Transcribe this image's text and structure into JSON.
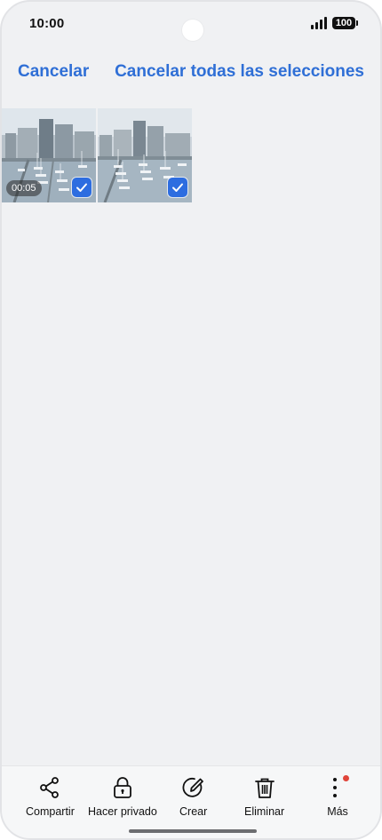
{
  "status_bar": {
    "time": "10:00",
    "battery": "100"
  },
  "header": {
    "cancel_label": "Cancelar",
    "cancel_all_label": "Cancelar todas las selecciones"
  },
  "gallery": {
    "items": [
      {
        "type": "video",
        "duration": "00:05",
        "selected": true
      },
      {
        "type": "photo",
        "selected": true
      }
    ]
  },
  "toolbar": {
    "items": [
      {
        "label": "Compartir",
        "icon": "share-icon"
      },
      {
        "label": "Hacer privado",
        "icon": "lock-icon"
      },
      {
        "label": "Crear",
        "icon": "create-icon"
      },
      {
        "label": "Eliminar",
        "icon": "trash-icon"
      },
      {
        "label": "Más",
        "icon": "more-vertical-icon",
        "has_badge": true
      }
    ]
  },
  "colors": {
    "accent": "#2f6fd6",
    "checkbox": "#2d6de0",
    "badge": "#e0453a",
    "background": "#f0f1f3"
  }
}
